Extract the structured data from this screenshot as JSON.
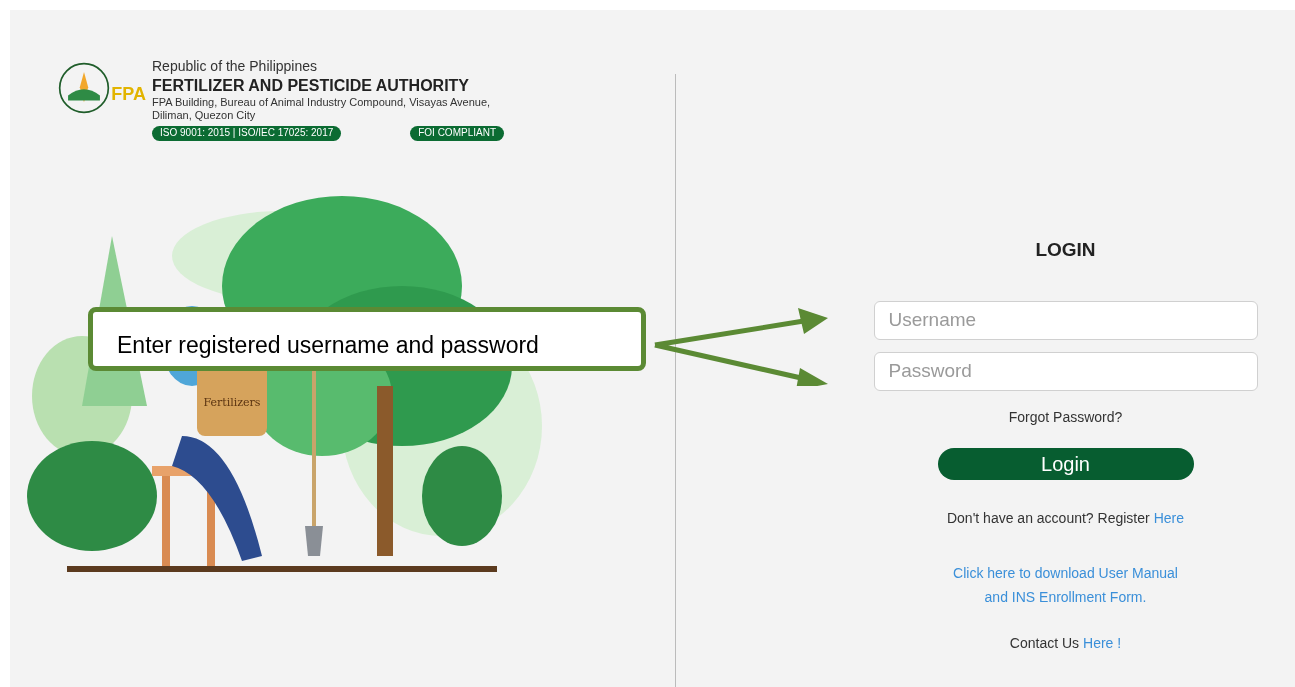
{
  "header": {
    "logo_text": "FPA",
    "line_1": "Republic of the Philippines",
    "title": "FERTILIZER AND PESTICIDE AUTHORITY",
    "address": "FPA Building, Bureau of Animal Industry Compound, Visayas Avenue, Diliman, Quezon City",
    "badges": [
      "ISO 9001: 2015 | ISO/IEC 17025: 2017",
      "FOI COMPLIANT"
    ]
  },
  "illustration": {
    "sack_label": "Fertilizers"
  },
  "callout": {
    "text": "Enter registered username and password"
  },
  "login": {
    "heading": "LOGIN",
    "fields": [
      {
        "placeholder": "Username"
      },
      {
        "placeholder": "Password"
      }
    ],
    "forgot": "Forgot Password?",
    "button": "Login",
    "register": {
      "text": "Don't have an account? Register",
      "link": "Here"
    },
    "manual_link": [
      "Click here to download User Manual",
      "and INS Enrollment Form."
    ],
    "contact": {
      "text": "Contact Us",
      "link": "Here !"
    }
  }
}
